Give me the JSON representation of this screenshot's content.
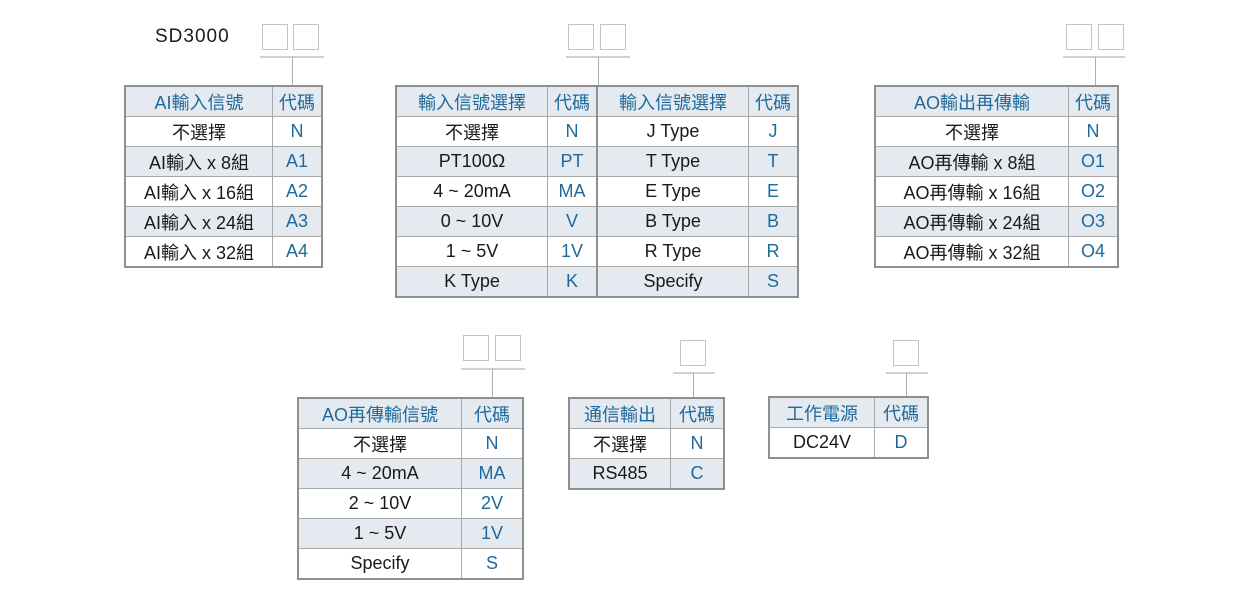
{
  "model": "SD3000",
  "ai_input": {
    "headers": [
      "AI輸入信號",
      "代碼"
    ],
    "rows": [
      [
        "不選擇",
        "N"
      ],
      [
        "AI輸入 x 8組",
        "A1"
      ],
      [
        "AI輸入 x 16組",
        "A2"
      ],
      [
        "AI輸入 x 24組",
        "A3"
      ],
      [
        "AI輸入 x 32組",
        "A4"
      ]
    ]
  },
  "input_signal": {
    "headers": [
      "輸入信號選擇",
      "代碼",
      "輸入信號選擇",
      "代碼"
    ],
    "rows": [
      [
        "不選擇",
        "N",
        "J Type",
        "J"
      ],
      [
        "PT100Ω",
        "PT",
        "T Type",
        "T"
      ],
      [
        "4 ~ 20mA",
        "MA",
        "E Type",
        "E"
      ],
      [
        "0 ~ 10V",
        "V",
        "B Type",
        "B"
      ],
      [
        "1 ~ 5V",
        "1V",
        "R Type",
        "R"
      ],
      [
        "K Type",
        "K",
        "Specify",
        "S"
      ]
    ]
  },
  "ao_output": {
    "headers": [
      "AO輸出再傳輸",
      "代碼"
    ],
    "rows": [
      [
        "不選擇",
        "N"
      ],
      [
        "AO再傳輸 x 8組",
        "O1"
      ],
      [
        "AO再傳輸 x 16組",
        "O2"
      ],
      [
        "AO再傳輸 x 24組",
        "O3"
      ],
      [
        "AO再傳輸 x 32組",
        "O4"
      ]
    ]
  },
  "ao_signal": {
    "headers": [
      "AO再傳輸信號",
      "代碼"
    ],
    "rows": [
      [
        "不選擇",
        "N"
      ],
      [
        "4 ~ 20mA",
        "MA"
      ],
      [
        "2 ~ 10V",
        "2V"
      ],
      [
        "1 ~ 5V",
        "1V"
      ],
      [
        "Specify",
        "S"
      ]
    ]
  },
  "comm_output": {
    "headers": [
      "通信輸出",
      "代碼"
    ],
    "rows": [
      [
        "不選擇",
        "N"
      ],
      [
        "RS485",
        "C"
      ]
    ]
  },
  "power": {
    "headers": [
      "工作電源",
      "代碼"
    ],
    "rows": [
      [
        "DC24V",
        "D"
      ]
    ]
  }
}
